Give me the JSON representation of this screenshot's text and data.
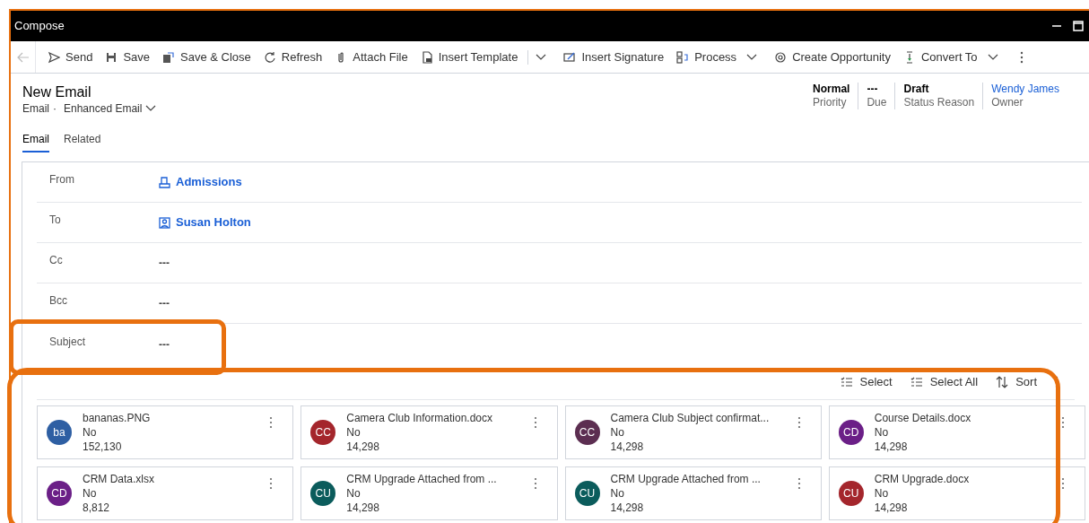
{
  "window": {
    "title": "Compose"
  },
  "toolbar": [
    {
      "label": "Send",
      "dropdown": false
    },
    {
      "label": "Save",
      "dropdown": false
    },
    {
      "label": "Save & Close",
      "dropdown": false
    },
    {
      "label": "Refresh",
      "dropdown": false
    },
    {
      "label": "Attach File",
      "dropdown": false
    },
    {
      "label": "Insert Template",
      "dropdown": true
    },
    {
      "label": "Insert Signature",
      "dropdown": false
    },
    {
      "label": "Process",
      "dropdown": true
    },
    {
      "label": "Create Opportunity",
      "dropdown": false
    },
    {
      "label": "Convert To",
      "dropdown": true
    }
  ],
  "header": {
    "title": "New Email",
    "entity": "Email",
    "separator": "·",
    "form": "Enhanced Email",
    "fields": [
      {
        "value": "Normal",
        "label": "Priority",
        "link": false
      },
      {
        "value": "---",
        "label": "Due",
        "link": false
      },
      {
        "value": "Draft",
        "label": "Status Reason",
        "link": false
      },
      {
        "value": "Wendy James",
        "label": "Owner",
        "link": true
      }
    ]
  },
  "tabs": [
    {
      "label": "Email",
      "selected": true
    },
    {
      "label": "Related",
      "selected": false
    }
  ],
  "form": [
    {
      "label": "From",
      "value": "Admissions",
      "kind": "queue"
    },
    {
      "label": "To",
      "value": "Susan Holton",
      "kind": "contact"
    },
    {
      "label": "Cc",
      "value": "---",
      "kind": "empty"
    },
    {
      "label": "Bcc",
      "value": "---",
      "kind": "empty"
    },
    {
      "label": "Subject",
      "value": "---",
      "kind": "empty"
    }
  ],
  "grid_commands": [
    {
      "label": "Select"
    },
    {
      "label": "Select All"
    },
    {
      "label": "Sort"
    }
  ],
  "attachments": [
    {
      "initials": "ba",
      "color": "#2e5fa3",
      "name": "bananas.PNG",
      "flag": "No",
      "size": "152,130"
    },
    {
      "initials": "CC",
      "color": "#a4262c",
      "name": "Camera Club Information.docx",
      "flag": "No",
      "size": "14,298"
    },
    {
      "initials": "CC",
      "color": "#5c2e51",
      "name": "Camera Club Subject confirmat...",
      "flag": "No",
      "size": "14,298"
    },
    {
      "initials": "CD",
      "color": "#6b1f87",
      "name": "Course Details.docx",
      "flag": "No",
      "size": "14,298"
    },
    {
      "initials": "CD",
      "color": "#6b1f87",
      "name": "CRM Data.xlsx",
      "flag": "No",
      "size": "8,812"
    },
    {
      "initials": "CU",
      "color": "#0b5c5c",
      "name": "CRM Upgrade Attached from ...",
      "flag": "No",
      "size": "14,298"
    },
    {
      "initials": "CU",
      "color": "#0b5c5c",
      "name": "CRM Upgrade Attached from ...",
      "flag": "No",
      "size": "14,298"
    },
    {
      "initials": "CU",
      "color": "#a4262c",
      "name": "CRM Upgrade.docx",
      "flag": "No",
      "size": "14,298"
    }
  ]
}
